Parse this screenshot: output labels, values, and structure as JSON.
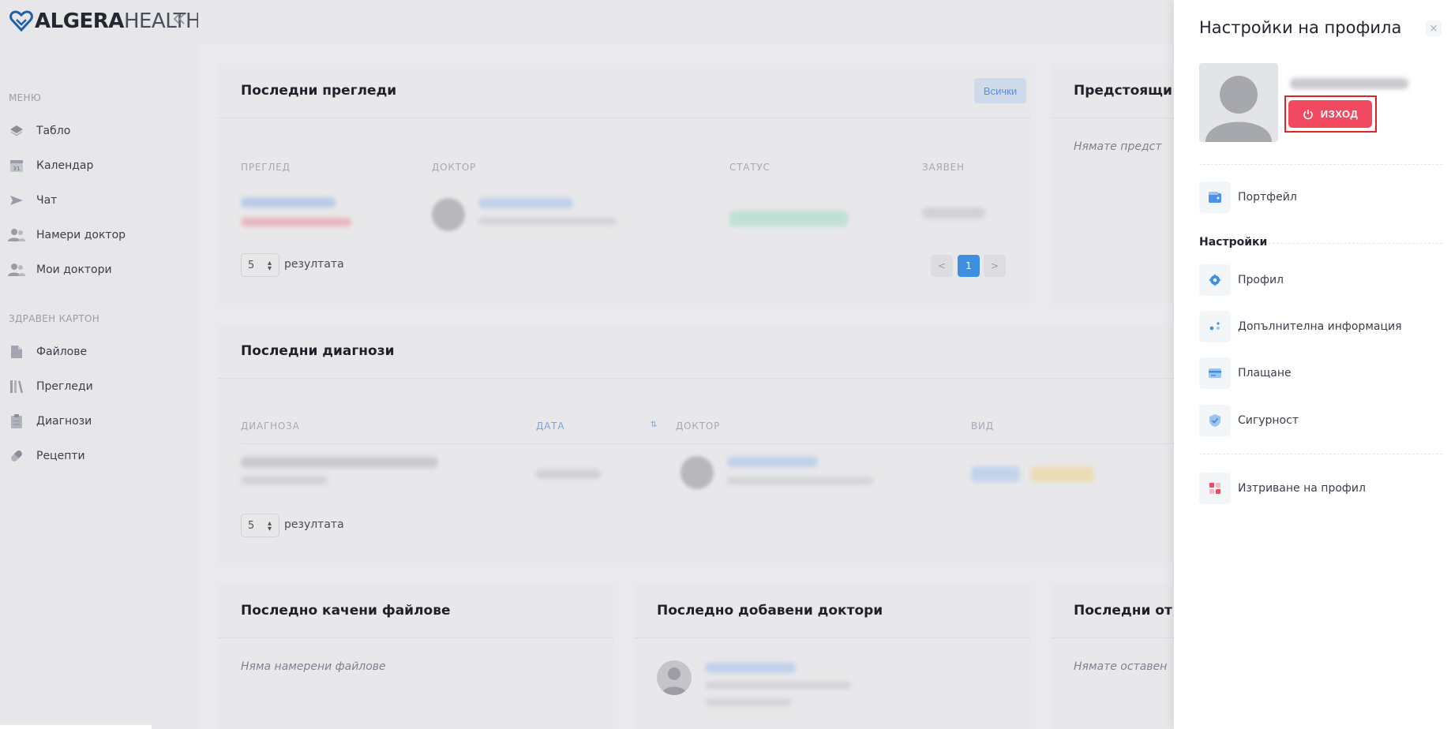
{
  "brand": {
    "name_bold": "ALGERA",
    "name_light": "HEALTH"
  },
  "sidebar": {
    "sections": [
      {
        "label": "МЕНЮ",
        "items": [
          {
            "label": "Табло",
            "icon": "layers-icon"
          },
          {
            "label": "Календар",
            "icon": "calendar-icon",
            "icon_text": "31"
          },
          {
            "label": "Чат",
            "icon": "send-icon"
          },
          {
            "label": "Намери доктор",
            "icon": "users-icon"
          },
          {
            "label": "Мои доктори",
            "icon": "users-icon"
          }
        ]
      },
      {
        "label": "ЗДРАВЕН КАРТОН",
        "items": [
          {
            "label": "Файлове",
            "icon": "file-icon"
          },
          {
            "label": "Прегледи",
            "icon": "library-icon"
          },
          {
            "label": "Диагнози",
            "icon": "clipboard-icon"
          },
          {
            "label": "Рецепти",
            "icon": "pill-icon"
          }
        ]
      }
    ]
  },
  "cards": {
    "recent_exams": {
      "title": "Последни прегледи",
      "all_button": "Всички",
      "columns": [
        "ПРЕГЛЕД",
        "ДОКТОР",
        "СТАТУС",
        "ЗАЯВЕН"
      ],
      "page_size": "5",
      "results_label": "резултата",
      "pagination": {
        "prev": "<",
        "current": "1",
        "next": ">"
      }
    },
    "upcoming": {
      "title": "Предстоящи",
      "empty": "Нямате предст"
    },
    "recent_diagnoses": {
      "title": "Последни диагнози",
      "columns": [
        "ДИАГНОЗА",
        "ДАТА",
        "ДОКТОР",
        "ВИД"
      ],
      "sort_icon_text": "⇅",
      "page_size": "5",
      "results_label": "резултата"
    },
    "recent_files": {
      "title": "Последно качени файлове",
      "empty": "Няма намерени файлове"
    },
    "recent_doctors": {
      "title": "Последно добавени доктори"
    },
    "recent_reviews": {
      "title": "Последни от",
      "empty": "Нямате оставен"
    }
  },
  "profile_panel": {
    "title": "Настройки на профила",
    "close_glyph": "×",
    "logout_label": "ИЗХОД",
    "wallet_label": "Портфейл",
    "settings_heading": "Настройки",
    "settings_items": [
      {
        "label": "Профил",
        "icon": "gear-icon"
      },
      {
        "label": "Допълнителна информация",
        "icon": "dots-icon"
      },
      {
        "label": "Плащане",
        "icon": "credit-card-icon"
      },
      {
        "label": "Сигурност",
        "icon": "shield-check-icon"
      }
    ],
    "delete_label": "Изтриване на профил",
    "colors": {
      "accent": "#3d8fe0",
      "danger": "#f1495f",
      "outline": "#e02424"
    }
  }
}
